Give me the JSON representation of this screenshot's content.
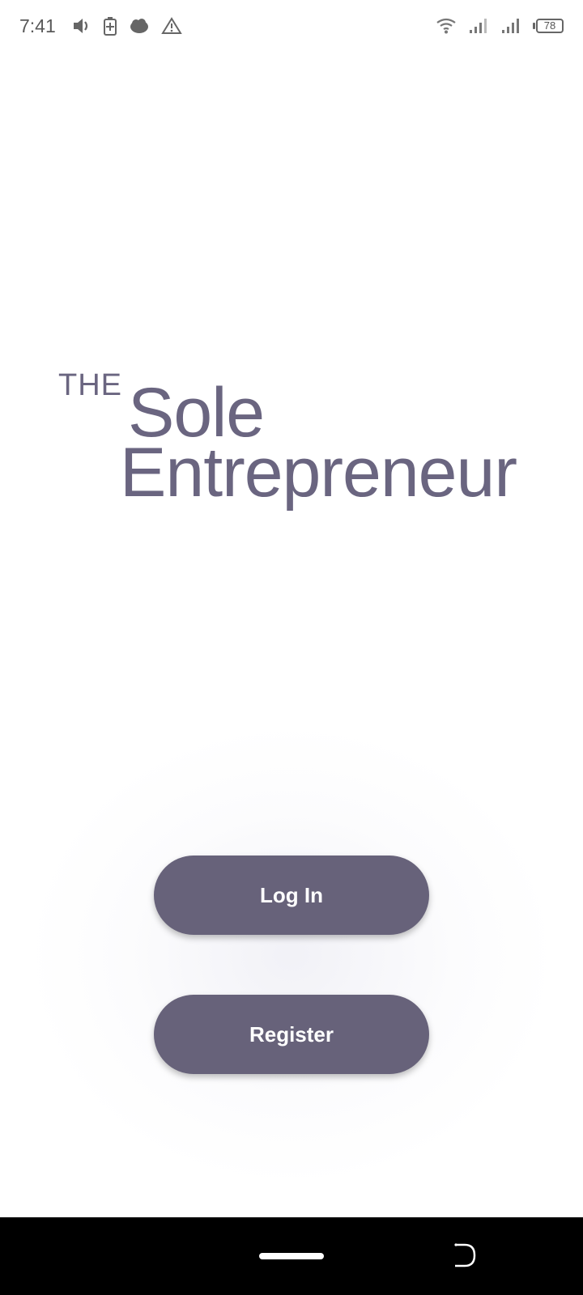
{
  "status_bar": {
    "time": "7:41",
    "left_icons": [
      "volume-icon",
      "battery-saver-icon",
      "cloud-icon",
      "warning-icon"
    ],
    "right_icons": [
      "wifi-icon",
      "signal-icon",
      "signal-icon",
      "battery-icon"
    ],
    "battery_level": "78"
  },
  "logo": {
    "the": "THE",
    "sole": "Sole",
    "entrepreneur": "Entrepreneur",
    "color": "#6a6580"
  },
  "actions": {
    "login_label": "Log In",
    "register_label": "Register",
    "button_color": "#67627a"
  },
  "nav": {
    "home": "home-pill",
    "back": "back-gesture-icon"
  }
}
